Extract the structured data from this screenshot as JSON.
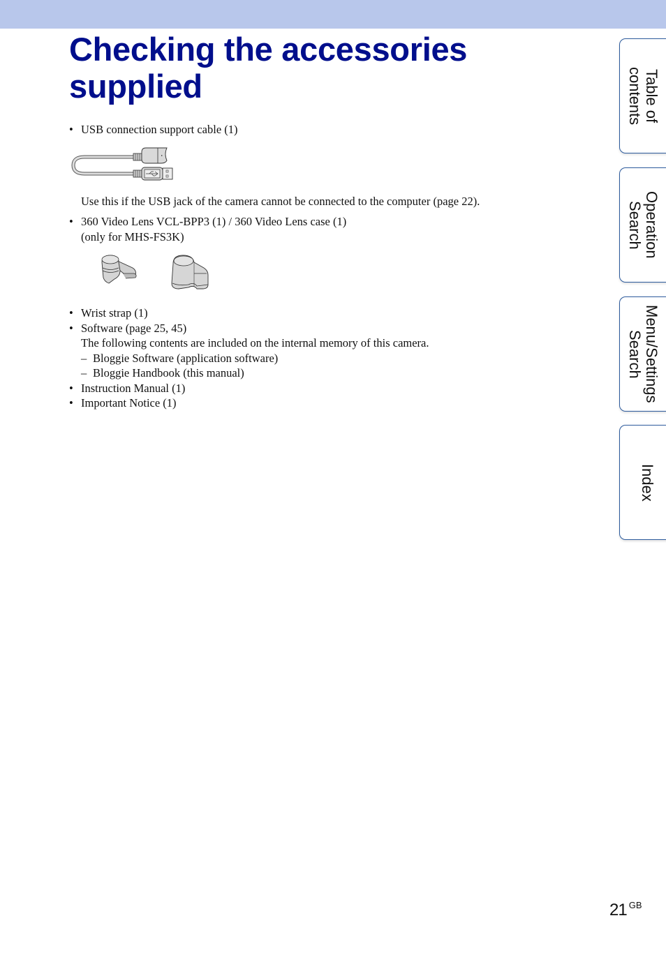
{
  "header": {
    "band_color": "#b8c7eb",
    "title_line1": "Checking the accessories",
    "title_line2": "supplied",
    "title_color": "#000e8c"
  },
  "content": {
    "usb_cable": {
      "bullet": "•",
      "label": "USB connection support cable (1)",
      "illustration": "usb-cable-illustration",
      "description": "Use this if the USB jack of the camera cannot be connected to the computer (page 22)."
    },
    "lens": {
      "bullet": "•",
      "label": "360 Video Lens VCL-BPP3 (1) / 360 Video Lens case (1)",
      "note": "(only for MHS-FS3K)",
      "illustrations": [
        "360-video-lens-illustration",
        "360-video-lens-case-illustration"
      ]
    },
    "items": [
      {
        "bullet": "•",
        "label": "Wrist strap (1)"
      },
      {
        "bullet": "•",
        "label": "Software (page 25, 45)"
      }
    ],
    "software_note": "The following contents are included on the internal memory of this camera.",
    "software_contents": [
      {
        "dash": "–",
        "label": "Bloggie Software (application software)"
      },
      {
        "dash": "–",
        "label": "Bloggie Handbook (this manual)"
      }
    ],
    "items_after": [
      {
        "bullet": "•",
        "label": "Instruction Manual (1)"
      },
      {
        "bullet": "•",
        "label": "Important Notice (1)"
      }
    ]
  },
  "side_tabs": [
    {
      "line1": "Table of",
      "line2": "contents"
    },
    {
      "line1": "Operation",
      "line2": "Search"
    },
    {
      "line1": "Menu/Settings",
      "line2": "Search"
    },
    {
      "line1": "Index",
      "line2": ""
    }
  ],
  "footer": {
    "page_number": "21",
    "page_suffix": "GB"
  }
}
